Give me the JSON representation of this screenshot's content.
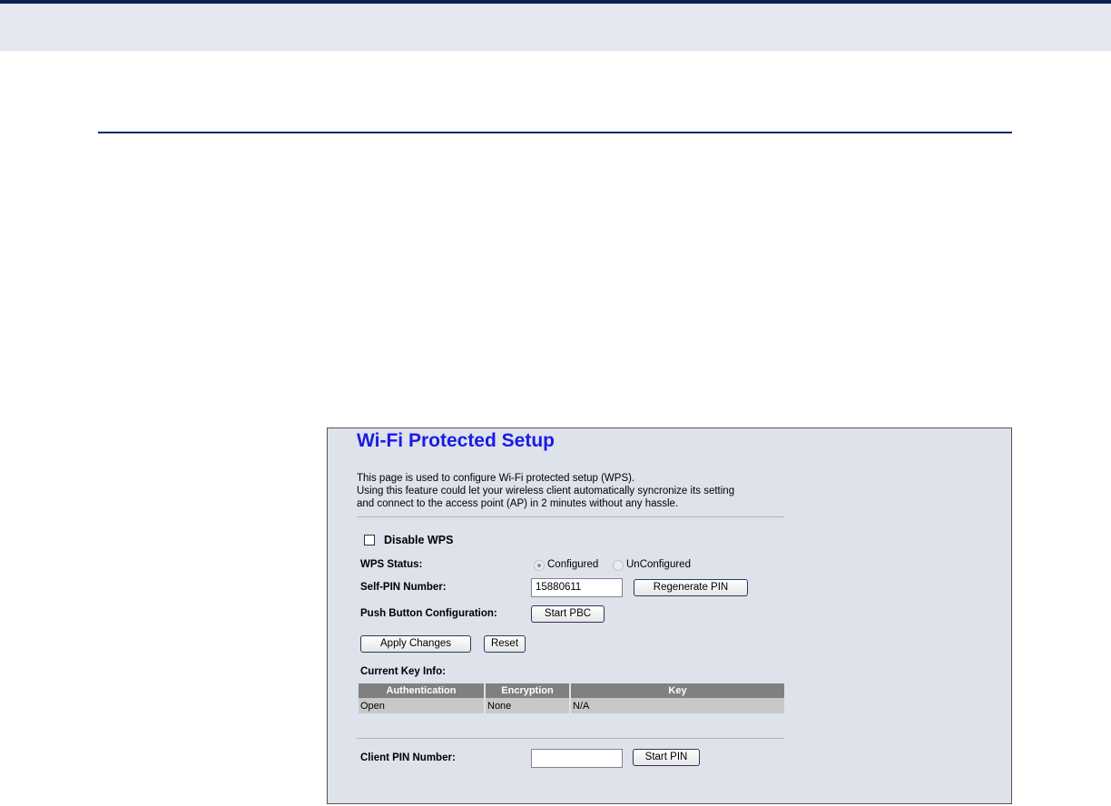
{
  "page": {
    "title": "Wi-Fi Protected Setup",
    "description": [
      "This page is used to configure Wi-Fi protected setup (WPS).",
      "Using this feature could let your wireless client automatically syncronize its setting",
      "and connect to the access point (AP) in 2 minutes without any hassle."
    ]
  },
  "disable_wps": {
    "label": "Disable WPS",
    "checked": false
  },
  "wps_status": {
    "label": "WPS Status:",
    "options": [
      "Configured",
      "UnConfigured"
    ],
    "selected": "Configured"
  },
  "self_pin": {
    "label": "Self-PIN Number:",
    "value": "15880611",
    "button": "Regenerate PIN"
  },
  "pbc": {
    "label": "Push Button Configuration:",
    "button": "Start PBC"
  },
  "actions": {
    "apply": "Apply Changes",
    "reset": "Reset"
  },
  "key_info": {
    "label": "Current Key Info:",
    "columns": [
      "Authentication",
      "Encryption",
      "Key"
    ],
    "rows": [
      [
        "Open",
        "None",
        "N/A"
      ]
    ]
  },
  "client_pin": {
    "label": "Client PIN Number:",
    "value": "",
    "button": "Start PIN"
  }
}
